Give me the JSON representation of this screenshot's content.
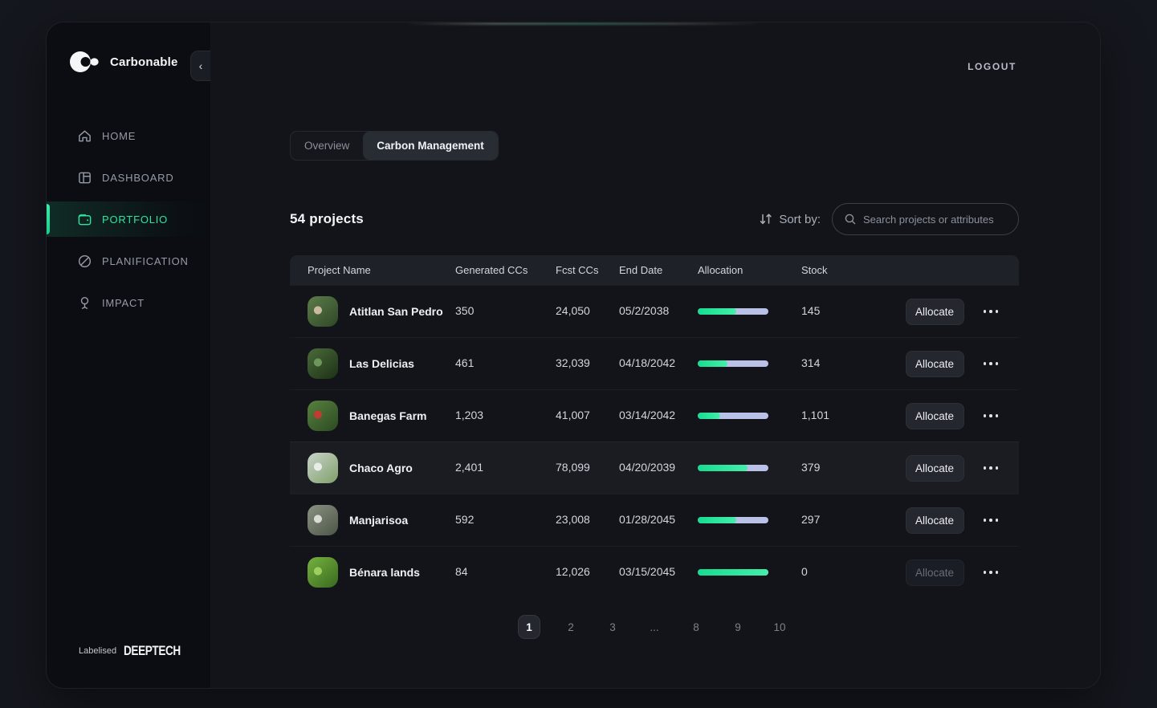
{
  "app": {
    "brand": "Carbonable",
    "logout_label": "LOGOUT"
  },
  "colors": {
    "accent_green": "#2ee5a0",
    "progress_from": "#15dd8f",
    "progress_to": "#45eeab",
    "progress_track": "#b9c1e6"
  },
  "sidebar": {
    "items": [
      {
        "label": "HOME",
        "icon": "home",
        "active": false
      },
      {
        "label": "DASHBOARD",
        "icon": "dashboard",
        "active": false
      },
      {
        "label": "PORTFOLIO",
        "icon": "portfolio",
        "active": true
      },
      {
        "label": "PLANIFICATION",
        "icon": "planification",
        "active": false
      },
      {
        "label": "IMPACT",
        "icon": "impact",
        "active": false
      }
    ],
    "footer": {
      "labelised": "Labelised",
      "deeptech": "DEEPTECH"
    }
  },
  "tabs": [
    {
      "label": "Overview",
      "active": false
    },
    {
      "label": "Carbon Management",
      "active": true
    }
  ],
  "toolbar": {
    "count": "54 projects",
    "sort_label": "Sort by:",
    "search_placeholder": "Search projects or attributes"
  },
  "table": {
    "columns": [
      "Project Name",
      "Generated CCs",
      "Fcst CCs",
      "End Date",
      "Allocation",
      "Stock"
    ],
    "allocate_label": "Allocate",
    "rows": [
      {
        "name": "Atitlan San Pedro",
        "generated": "350",
        "fcst": "24,050",
        "end_date": "05/2/2038",
        "allocation_pct": 54,
        "stock": "145",
        "allocate_enabled": true,
        "highlighted": false,
        "avatar_colors": [
          "#5d7c4a",
          "#2e4726",
          "#cbb9a0"
        ]
      },
      {
        "name": "Las Delicias",
        "generated": "461",
        "fcst": "32,039",
        "end_date": "04/18/2042",
        "allocation_pct": 42,
        "stock": "314",
        "allocate_enabled": true,
        "highlighted": false,
        "avatar_colors": [
          "#4a6b3a",
          "#1d3116",
          "#6f965a"
        ]
      },
      {
        "name": "Banegas Farm",
        "generated": "1,203",
        "fcst": "41,007",
        "end_date": "03/14/2042",
        "allocation_pct": 32,
        "stock": "1,101",
        "allocate_enabled": true,
        "highlighted": false,
        "avatar_colors": [
          "#57813f",
          "#2c4a22",
          "#c23b30"
        ]
      },
      {
        "name": "Chaco Agro",
        "generated": "2,401",
        "fcst": "78,099",
        "end_date": "04/20/2039",
        "allocation_pct": 71,
        "stock": "379",
        "allocate_enabled": true,
        "highlighted": true,
        "avatar_colors": [
          "#c9d3c9",
          "#7fa06a",
          "#e9ede7"
        ]
      },
      {
        "name": "Manjarisoa",
        "generated": "592",
        "fcst": "23,008",
        "end_date": "01/28/2045",
        "allocation_pct": 55,
        "stock": "297",
        "allocate_enabled": true,
        "highlighted": false,
        "avatar_colors": [
          "#8a9282",
          "#4b5546",
          "#d8dcd2"
        ]
      },
      {
        "name": "Bénara lands",
        "generated": "84",
        "fcst": "12,026",
        "end_date": "03/15/2045",
        "allocation_pct": 100,
        "stock": "0",
        "allocate_enabled": false,
        "highlighted": false,
        "avatar_colors": [
          "#76b13f",
          "#39691f",
          "#9ccf5e"
        ]
      }
    ]
  },
  "pagination": {
    "pages": [
      "1",
      "2",
      "3",
      "...",
      "8",
      "9",
      "10"
    ],
    "active_page": "1"
  }
}
